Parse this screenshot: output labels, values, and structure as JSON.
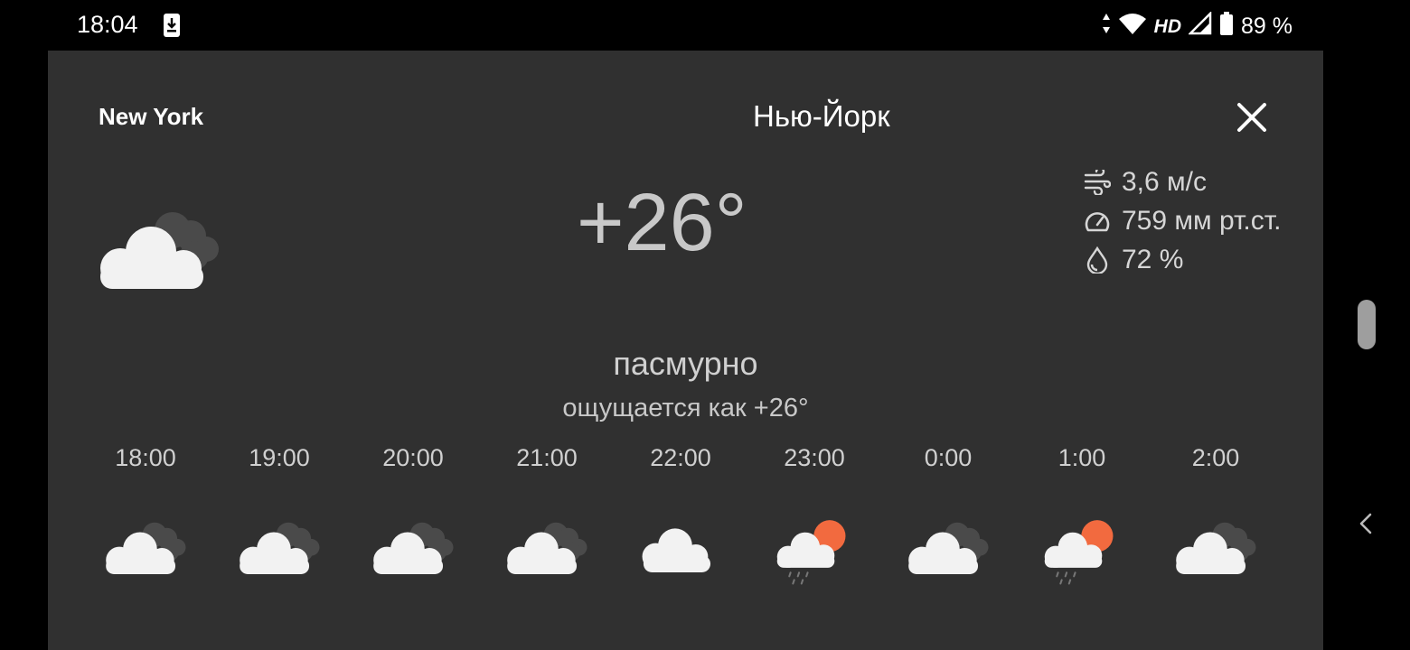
{
  "status_bar": {
    "time": "18:04",
    "network": "HD",
    "battery": "89 %",
    "icons": [
      "download-icon",
      "data-arrows-icon",
      "wifi-icon",
      "signal-icon",
      "battery-icon"
    ]
  },
  "weather": {
    "city_en": "New York",
    "city_ru": "Нью-Йорк",
    "temperature": "+26°",
    "condition": "пасмурно",
    "feels_like": "ощущается как +26°",
    "current_icon": "cloudy-icon",
    "metrics": [
      {
        "icon": "wind-icon",
        "value": "3,6 м/с"
      },
      {
        "icon": "pressure-gauge-icon",
        "value": "759 мм рт.ст."
      },
      {
        "icon": "humidity-drop-icon",
        "value": "72 %"
      }
    ],
    "hourly": [
      {
        "time": "18:00",
        "icon": "cloudy-icon"
      },
      {
        "time": "19:00",
        "icon": "cloudy-icon"
      },
      {
        "time": "20:00",
        "icon": "cloudy-icon"
      },
      {
        "time": "21:00",
        "icon": "cloudy-icon"
      },
      {
        "time": "22:00",
        "icon": "cloud-icon"
      },
      {
        "time": "23:00",
        "icon": "sun-cloud-rain-icon"
      },
      {
        "time": "0:00",
        "icon": "cloudy-icon"
      },
      {
        "time": "1:00",
        "icon": "sun-cloud-rain-icon"
      },
      {
        "time": "2:00",
        "icon": "cloudy-icon"
      }
    ]
  },
  "colors": {
    "card": "#303030",
    "sun": "#f26a3f",
    "cloud": "#f2f2f2",
    "back_cloud": "#4a4a4a"
  }
}
